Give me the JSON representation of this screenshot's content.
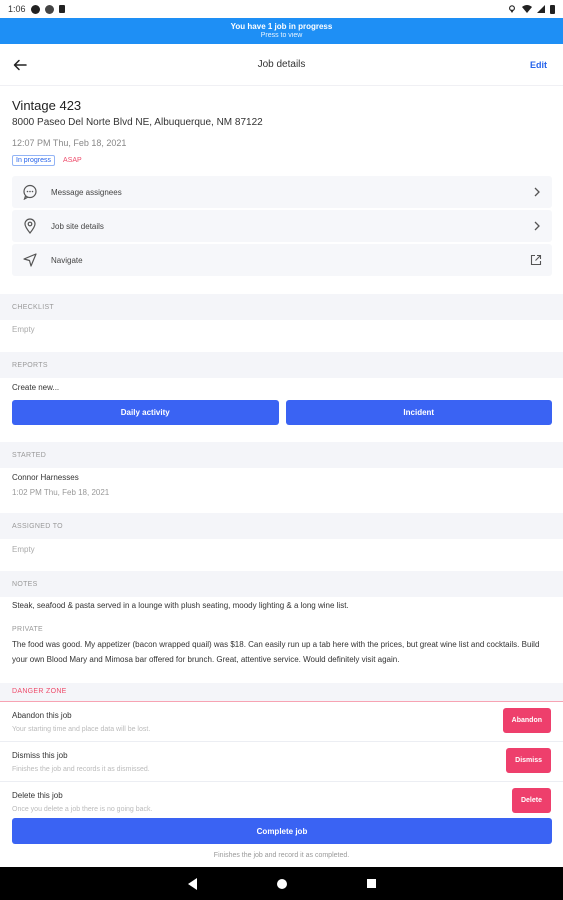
{
  "statusbar": {
    "time": "1:06"
  },
  "banner": {
    "line1": "You have 1 job in progress",
    "line2": "Press to view"
  },
  "appbar": {
    "title": "Job details",
    "edit_label": "Edit"
  },
  "job": {
    "name": "Vintage 423",
    "address": "8000 Paseo Del Norte Blvd NE, Albuquerque, NM 87122",
    "datetime": "12:07 PM Thu, Feb 18, 2021",
    "status_badge": "In progress",
    "priority_badge": "ASAP"
  },
  "actions": [
    {
      "label": "Message assignees",
      "icon": "chat-bubble-icon"
    },
    {
      "label": "Job site details",
      "icon": "location-pin-icon"
    },
    {
      "label": "Navigate",
      "icon": "navigation-arrow-icon"
    }
  ],
  "checklist": {
    "header": "CHECKLIST",
    "empty": "Empty"
  },
  "reports": {
    "header": "REPORTS",
    "create_label": "Create new...",
    "daily_activity_label": "Daily activity",
    "incident_label": "Incident"
  },
  "started": {
    "header": "STARTED",
    "name": "Connor Harnesses",
    "time": "1:02 PM Thu, Feb 18, 2021"
  },
  "assigned": {
    "header": "ASSIGNED TO",
    "empty": "Empty"
  },
  "notes": {
    "header": "NOTES",
    "public_text": "Steak, seafood & pasta served in a lounge with plush seating, moody lighting & a long wine list.",
    "private_label": "PRIVATE",
    "private_text": "The food was good. My appetizer (bacon wrapped quail) was $18. Can easily run up a tab here with the prices, but great wine list and cocktails. Build your own Blood Mary and Mimosa bar offered for brunch. Great, attentive service. Would definitely visit again."
  },
  "danger": {
    "header": "DANGER ZONE",
    "abandon": {
      "title": "Abandon this job",
      "subtitle": "Your starting time and place data will be lost.",
      "button": "Abandon"
    },
    "dismiss": {
      "title": "Dismiss this job",
      "subtitle": "Finishes the job and records it as dismissed.",
      "button": "Dismiss"
    },
    "delete": {
      "title": "Delete this job",
      "subtitle": "Once you delete a job there is no going back.",
      "button": "Delete"
    }
  },
  "complete": {
    "button": "Complete job",
    "hint": "Finishes the job and record it as completed."
  },
  "colors": {
    "accent": "#3a63f3",
    "banner": "#1e8ff5",
    "danger": "#ee3f6c"
  }
}
